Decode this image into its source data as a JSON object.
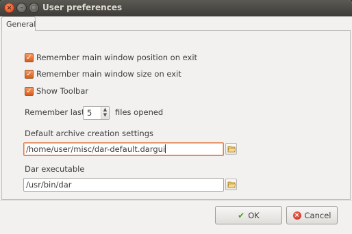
{
  "window": {
    "title": "User preferences",
    "close_glyph": "×",
    "minimize_glyph": "–",
    "maximize_glyph": "□"
  },
  "tabs": [
    {
      "label": "General",
      "selected": true
    }
  ],
  "options": {
    "remember_position": {
      "label": "Remember main window position on exit",
      "checked": true
    },
    "remember_size": {
      "label": "Remember main window size on exit",
      "checked": true
    },
    "show_toolbar": {
      "label": "Show Toolbar",
      "checked": true
    }
  },
  "remember_last": {
    "prefix": "Remember last",
    "value": "5",
    "suffix": "files opened"
  },
  "archive_settings": {
    "label": "Default archive creation settings",
    "value": "/home/user/misc/dar-default.dargui",
    "icon": "folder-open-icon"
  },
  "dar_executable": {
    "label": "Dar executable",
    "value": "/usr/bin/dar",
    "icon": "folder-open-icon"
  },
  "buttons": {
    "ok": "OK",
    "cancel": "Cancel"
  },
  "colors": {
    "accent": "#e17d4b",
    "checkbox": "#d85b1e",
    "titlebar": "#3d3c38",
    "ok_icon": "#4b9c21",
    "cancel_icon": "#c4281a"
  }
}
